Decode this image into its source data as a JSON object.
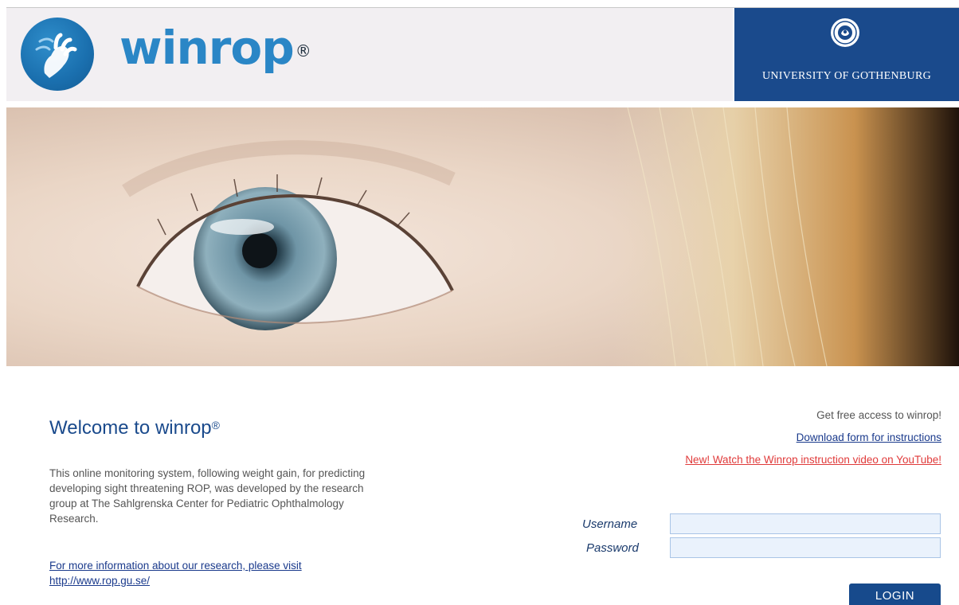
{
  "header": {
    "brand": "winrop",
    "brand_mark": "®",
    "university": "UNIVERSITY OF GOTHENBURG",
    "colors": {
      "brand_blue": "#2a86c6",
      "university_bg": "#1a4a8c",
      "header_bg": "#f2eff2"
    }
  },
  "hero": {
    "icon": "child-eye-photo"
  },
  "intro": {
    "title": "Welcome to winrop",
    "title_mark": "®",
    "description": "This online monitoring system, following weight gain, for predicting developing sight threatening ROP, was developed by the research group at The Sahlgrenska Center for Pediatric Ophthalmology Research.",
    "more_info_text": "For more information about our research, please visit",
    "more_info_url": "http://www.rop.gu.se/"
  },
  "access": {
    "free_access": "Get free access to winrop!",
    "download_link": "Download form for instructions",
    "video_link": "New! Watch the Winrop instruction video on YouTube!",
    "colors": {
      "video_link": "#e03a3a"
    }
  },
  "login": {
    "username_label": "Username",
    "username_value": "",
    "password_label": "Password",
    "password_value": "",
    "button": "LOGIN"
  }
}
